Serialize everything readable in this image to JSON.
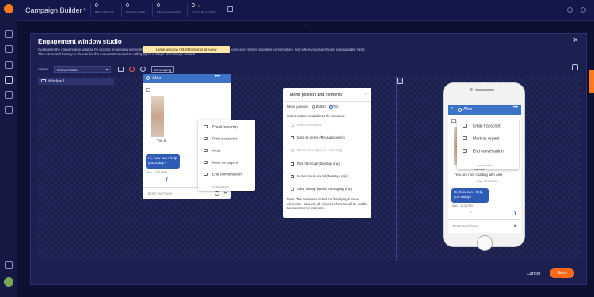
{
  "app": {
    "title": "Campaign Builder",
    "stats": [
      {
        "value": "0",
        "label": "PROSPECTS"
      },
      {
        "value": "0",
        "label": "EXPOSURES"
      },
      {
        "value": "0",
        "label": "ENGAGEMENTS"
      },
      {
        "value": "0",
        "sup": "+0",
        "label": "GOAL REACHED"
      }
    ]
  },
  "modal": {
    "title": "Engagement window studio",
    "description": "Customize the conversation window by clicking on window elements. Include surveys to collect additional information on your consumer before and after conversation, and when your agents are not available. Note: The colors and fonts you choose for the conversation window will apply to surveys and dialogs as well.",
    "views_label": "Views:",
    "views_value": "Conversation",
    "messaging_label": "Messaging",
    "window_item": "Window 1",
    "warning": "Large window not reflected in preview",
    "cancel": "Cancel",
    "save": "Save"
  },
  "desktop_chat": {
    "agent": "Alex",
    "you_are": "You a",
    "agent_message": "Hi, how can I help you today?",
    "meta": "Alex - 12:31 PM",
    "input_placeholder": "Enter text here",
    "menu": [
      "Email transcript",
      "Print transcript",
      "Mute",
      "Mark as urgent",
      "End conversation"
    ],
    "menu_footer": "LIVEPERSON"
  },
  "panel": {
    "title": "Menu position and elements",
    "position_label": "Menu position:",
    "position_options": [
      "Bottom",
      "Top"
    ],
    "selected_position": "Top",
    "subtitle": "Select actions available to the consumer",
    "options": [
      {
        "label": "End conversation",
        "state": "disabled"
      },
      {
        "label": "Mark as urgent (Messaging only)",
        "state": "checked"
      },
      {
        "label": "Email transcript (Live chat only)",
        "state": "disabled"
      },
      {
        "label": "Print transcript (Desktop only)",
        "state": "checked"
      },
      {
        "label": "Mute/unmute sound (Desktop only)",
        "state": "checked"
      },
      {
        "label": "Clear History (wealth messaging only)",
        "state": "unchecked"
      }
    ],
    "note": "Note: The preview is limited for displaying 6 menu elements. However, all selected elements will be visible to consumers in real time."
  },
  "mobile_chat": {
    "agent": "Alex",
    "now": "Not 30",
    "chatting": "You are now chatting with Alex",
    "sys_meta": "Info - 12:30 PM",
    "agent_message": "Hi, how can I help you today?",
    "meta": "Alex - 12:31 PM",
    "input_placeholder": "Enter text here",
    "menu": [
      "Email transcript",
      "Mark as urgent",
      "End conversation"
    ],
    "menu_footer": "LIVEPERSON"
  }
}
